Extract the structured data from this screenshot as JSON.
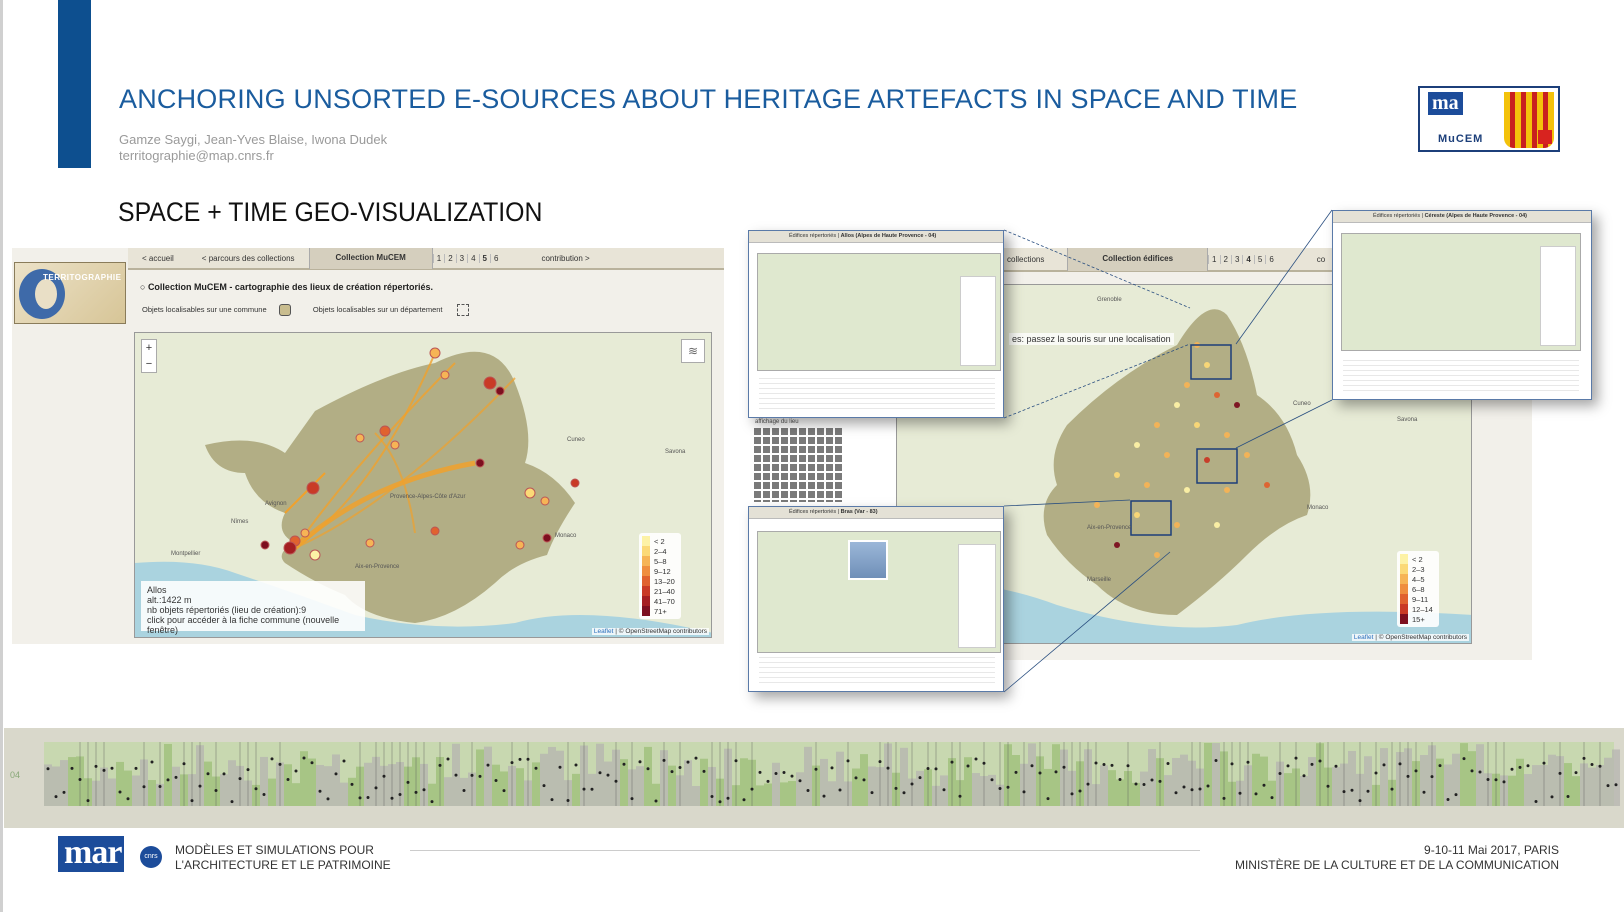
{
  "slide": {
    "title": "ANCHORING UNSORTED E-SOURCES ABOUT HERITAGE ARTEFACTS IN SPACE AND TIME",
    "authors": "Gamze Saygi, Jean-Yves Blaise, Iwona Dudek",
    "email": "territographie@map.cnrs.fr",
    "section_title": "SPACE + TIME GEO-VISUALIZATION",
    "logo_map_text": "ma",
    "logo_mucem_text": "MuCEM",
    "accent_color": "#0d4f8f",
    "title_color": "#1a5c9e"
  },
  "left_app": {
    "logo_text": "TERRITOGRAPHIE",
    "nav": {
      "accueil": "< accueil",
      "parcours": "< parcours des collections",
      "active_tab": "Collection MuCEM",
      "pages": [
        "1",
        "2",
        "3",
        "4",
        "5",
        "6"
      ],
      "active_page": "5",
      "contribution": "contribution >"
    },
    "heading": "Collection MuCEM - cartographie des lieux de création répertoriés.",
    "legend_commune": "Objets localisables sur une commune",
    "legend_departement": "Objets localisables sur un département",
    "zoom_in": "+",
    "zoom_out": "−",
    "info": {
      "name": "Allos",
      "alt": "alt.:1422 m",
      "count": "nb objets répertoriés (lieu de création):9",
      "hint": "click pour accéder à la fiche commune (nouvelle fenêtre)"
    },
    "legend": [
      "< 2",
      "2–4",
      "5–8",
      "9–12",
      "13–20",
      "21–40",
      "41–70",
      "71+"
    ],
    "legend_colors": [
      "#fdf2a6",
      "#fbd977",
      "#f6b456",
      "#ef8e3f",
      "#e0622f",
      "#c93a26",
      "#a51f22",
      "#7d0f1f"
    ],
    "map_labels": [
      "Avignon",
      "Nîmes",
      "Montpellier",
      "Cuneo",
      "Savona",
      "Monaco",
      "Aix-en-Provence",
      "Provence-Alpes-Côte d'Azur"
    ],
    "attribution_leaflet": "Leaflet",
    "attribution_osm": "© OpenStreetMap contributors"
  },
  "right_app": {
    "nav": {
      "left_fragment": "collections",
      "active_tab": "Collection édifices",
      "pages": [
        "1",
        "2",
        "3",
        "4",
        "5",
        "6"
      ],
      "active_page": "4",
      "right_fragment": "co"
    },
    "hover_tip": "es: passez la souris sur une localisation",
    "legend": [
      "< 2",
      "2–3",
      "4–5",
      "6–8",
      "9–11",
      "12–14",
      "15+"
    ],
    "legend_colors": [
      "#fdf2a6",
      "#fbd977",
      "#f6b456",
      "#ef8e3f",
      "#e0622f",
      "#c93a26",
      "#7d0f1f"
    ],
    "map_labels": [
      "Grenoble",
      "Cuneo",
      "Savona",
      "Monaco",
      "Aix-en-Provence",
      "Marseille"
    ],
    "attribution_leaflet": "Leaflet",
    "attribution_osm": "© OpenStreetMap contributors",
    "grid_label": "affichage du lieu"
  },
  "screenshots": {
    "s1_title": "Allos (Alpes de Haute Provence - 04)",
    "s1_sub": "Édifices répertoriés",
    "s2_title": "Céreste (Alpes de Haute Provence - 04)",
    "s2_sub": "Édifices répertoriés",
    "s3_title": "Bras (Var - 83)",
    "s3_sub": "Édifices répertoriés"
  },
  "timeline": {
    "label": "04"
  },
  "footer": {
    "logo_text": "mar",
    "cnrs_text": "cnrs",
    "line1": "MODÈLES ET SIMULATIONS POUR",
    "line2": "L'ARCHITECTURE ET LE PATRIMOINE",
    "date": "9-10-11 Mai 2017, PARIS",
    "ministry": "MINISTÈRE DE LA CULTURE ET DE LA COMMUNICATION"
  }
}
